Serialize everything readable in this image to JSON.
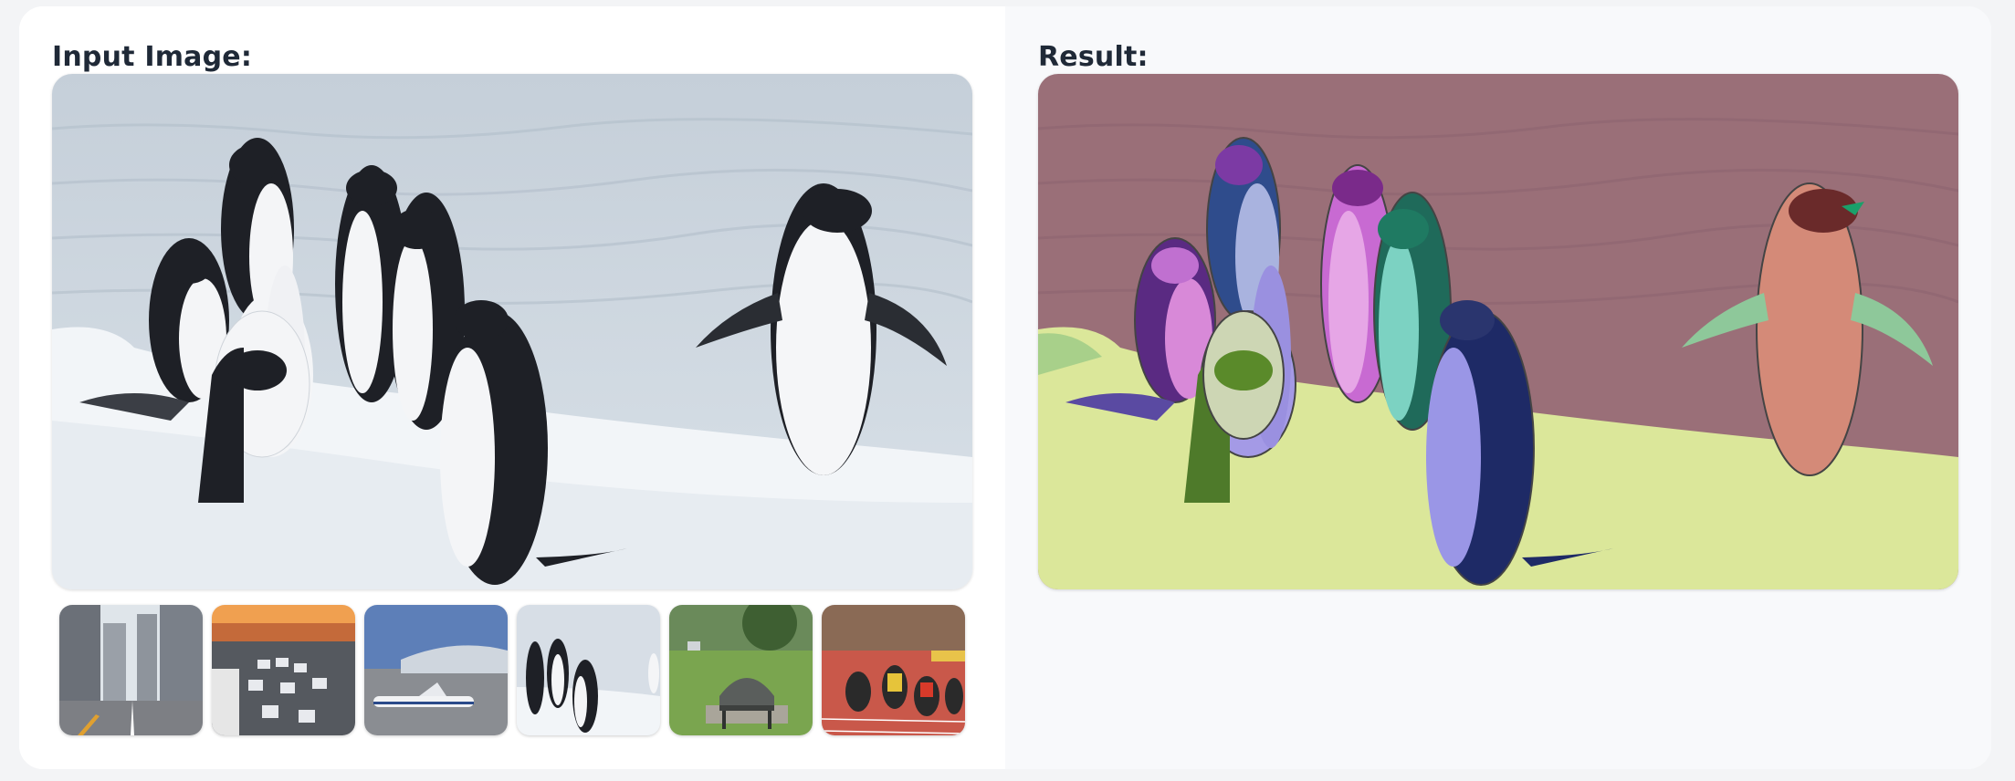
{
  "input_panel": {
    "title": "Input Image:",
    "main_image_subject": "penguins-on-snow",
    "examples": [
      {
        "subject": "city-street"
      },
      {
        "subject": "traffic-highway-sunset"
      },
      {
        "subject": "airport-airplane"
      },
      {
        "subject": "penguins"
      },
      {
        "subject": "park-bench"
      },
      {
        "subject": "sprinters-race"
      }
    ]
  },
  "result_panel": {
    "title": "Result:",
    "image_subject": "penguins-segmentation-overlay"
  },
  "colors": {
    "sea": "#a9b6c4",
    "snow": "#f1f4f7",
    "overlay_sea": "#9a6f78",
    "overlay_snow": "#dbe79a"
  }
}
